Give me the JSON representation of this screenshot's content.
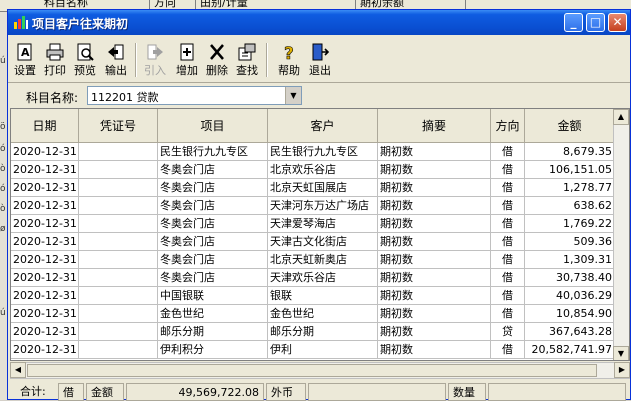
{
  "back_window": {
    "headers": [
      "科目名称",
      "方向",
      "由别/计量",
      "期初余额"
    ]
  },
  "window": {
    "title": "项目客户往来期初",
    "controls": [
      "minimize",
      "maximize",
      "close"
    ]
  },
  "toolbar": {
    "buttons": [
      {
        "label": "设置",
        "icon": "settings-icon",
        "enabled": true
      },
      {
        "label": "打印",
        "icon": "print-icon",
        "enabled": true
      },
      {
        "label": "预览",
        "icon": "preview-icon",
        "enabled": true
      },
      {
        "label": "输出",
        "icon": "export-icon",
        "enabled": true
      },
      {
        "label": "引入",
        "icon": "import-icon",
        "enabled": false
      },
      {
        "label": "增加",
        "icon": "add-icon",
        "enabled": true
      },
      {
        "label": "删除",
        "icon": "delete-icon",
        "enabled": true
      },
      {
        "label": "查找",
        "icon": "find-icon",
        "enabled": true
      },
      {
        "label": "帮助",
        "icon": "help-icon",
        "enabled": true
      },
      {
        "label": "退出",
        "icon": "exit-icon",
        "enabled": true
      }
    ]
  },
  "filter": {
    "label": "科目名称:",
    "value": "112201 贷款"
  },
  "grid": {
    "columns": [
      "日期",
      "凭证号",
      "项目",
      "客户",
      "摘要",
      "方向",
      "金额"
    ],
    "rows": [
      [
        "2020-12-31",
        "",
        "民生银行九九专区",
        "民生银行九九专区",
        "期初数",
        "借",
        "8,679.35"
      ],
      [
        "2020-12-31",
        "",
        "冬奥会门店",
        "北京欢乐谷店",
        "期初数",
        "借",
        "106,151.05"
      ],
      [
        "2020-12-31",
        "",
        "冬奥会门店",
        "北京天虹国展店",
        "期初数",
        "借",
        "1,278.77"
      ],
      [
        "2020-12-31",
        "",
        "冬奥会门店",
        "天津河东万达广场店",
        "期初数",
        "借",
        "638.62"
      ],
      [
        "2020-12-31",
        "",
        "冬奥会门店",
        "天津爱琴海店",
        "期初数",
        "借",
        "1,769.22"
      ],
      [
        "2020-12-31",
        "",
        "冬奥会门店",
        "天津古文化街店",
        "期初数",
        "借",
        "509.36"
      ],
      [
        "2020-12-31",
        "",
        "冬奥会门店",
        "北京天虹新奥店",
        "期初数",
        "借",
        "1,309.31"
      ],
      [
        "2020-12-31",
        "",
        "冬奥会门店",
        "天津欢乐谷店",
        "期初数",
        "借",
        "30,738.40"
      ],
      [
        "2020-12-31",
        "",
        "中国银联",
        "银联",
        "期初数",
        "借",
        "40,036.29"
      ],
      [
        "2020-12-31",
        "",
        "金色世纪",
        "金色世纪",
        "期初数",
        "借",
        "10,854.90"
      ],
      [
        "2020-12-31",
        "",
        "邮乐分期",
        "邮乐分期",
        "期初数",
        "贷",
        "367,643.28"
      ],
      [
        "2020-12-31",
        "",
        "伊利积分",
        "伊利",
        "期初数",
        "借",
        "20,582,741.97"
      ]
    ]
  },
  "footer": {
    "total_label": "合计:",
    "direction": "借",
    "amount_label": "金额",
    "amount_value": "49,569,722.08",
    "foreign_label": "外币",
    "foreign_value": "",
    "qty_label": "数量",
    "qty_value": ""
  }
}
